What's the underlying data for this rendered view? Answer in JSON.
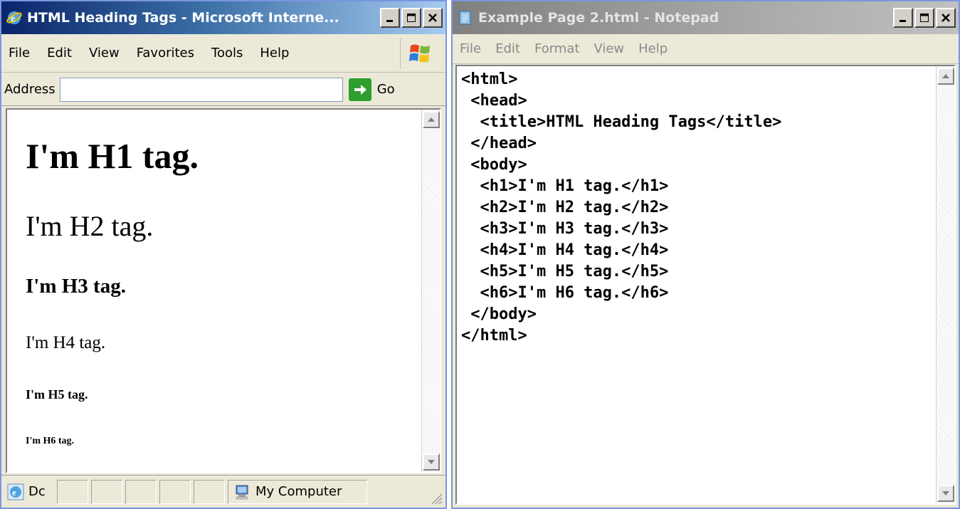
{
  "ie": {
    "title": "HTML Heading Tags - Microsoft Interne...",
    "menu": {
      "file": "File",
      "edit": "Edit",
      "view": "View",
      "favorites": "Favorites",
      "tools": "Tools",
      "help": "Help"
    },
    "address": {
      "label": "Address",
      "value": "",
      "go_label": "Go"
    },
    "page": {
      "h1": "I'm H1 tag.",
      "h2": "I'm H2 tag.",
      "h3": "I'm H3 tag.",
      "h4": "I'm H4 tag.",
      "h5": "I'm H5 tag.",
      "h6": "I'm H6 tag."
    },
    "status": {
      "text": "Dc",
      "zone": "My Computer"
    }
  },
  "notepad": {
    "title": "Example Page 2.html - Notepad",
    "menu": {
      "file": "File",
      "edit": "Edit",
      "format": "Format",
      "view": "View",
      "help": "Help"
    },
    "lines": [
      "<html>",
      " <head>",
      "  <title>HTML Heading Tags</title>",
      " </head>",
      " <body>",
      "  <h1>I'm H1 tag.</h1>",
      "  <h2>I'm H2 tag.</h2>",
      "  <h3>I'm H3 tag.</h3>",
      "  <h4>I'm H4 tag.</h4>",
      "  <h5>I'm H5 tag.</h5>",
      "  <h6>I'm H6 tag.</h6>",
      " </body>",
      "</html>"
    ]
  },
  "colors": {
    "active_titlebar": "#0a246a",
    "inactive_titlebar": "#808080",
    "window_bg": "#ece9d8",
    "go_green": "#2e9e2e"
  },
  "icons": {
    "ie_app": "ie-logo-icon",
    "notepad_app": "notepad-icon",
    "minimize": "minimize-icon",
    "maximize": "maximize-icon",
    "close": "close-icon",
    "windows_flag": "windows-flag-icon",
    "go": "go-arrow-icon",
    "dropdown": "chevron-down-icon",
    "my_computer": "computer-icon"
  }
}
